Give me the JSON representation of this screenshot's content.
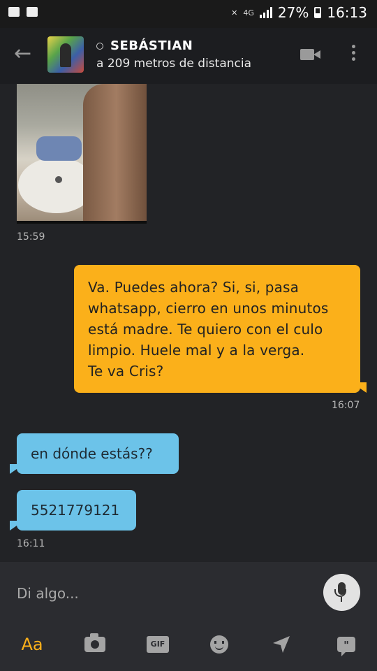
{
  "status_bar": {
    "network": "4G",
    "battery": "27%",
    "clock": "16:13"
  },
  "header": {
    "back_icon": "arrow-left-icon",
    "contact_name": "SEBÁSTIAN",
    "distance": "a 209 metros de distancia"
  },
  "messages": [
    {
      "type": "image",
      "direction": "incoming",
      "time": "15:59"
    },
    {
      "type": "text",
      "direction": "outgoing",
      "text": "Va. Puedes ahora? Si, si, pasa\nwhatsapp, cierro en unos minutos\nestá madre.   Te quiero con el culo\nlimpio. Huele mal y a la verga.\nTe va Cris?",
      "time": "16:07"
    },
    {
      "type": "text",
      "direction": "incoming",
      "text": "en dónde estás??"
    },
    {
      "type": "text",
      "direction": "incoming",
      "text": "5521779121",
      "time": "16:11"
    }
  ],
  "composer": {
    "placeholder": "Di algo...",
    "format_label": "Aa",
    "gif_label": "GIF",
    "phrases_label": "\"",
    "icons": [
      "text-format-icon",
      "camera-icon",
      "gif-icon",
      "smiley-icon",
      "send-location-icon",
      "saved-phrases-icon",
      "microphone-icon"
    ]
  },
  "colors": {
    "background": "#222326",
    "outgoing_bubble": "#fbb01a",
    "incoming_bubble": "#6cc3e9",
    "accent": "#fbb01a"
  }
}
